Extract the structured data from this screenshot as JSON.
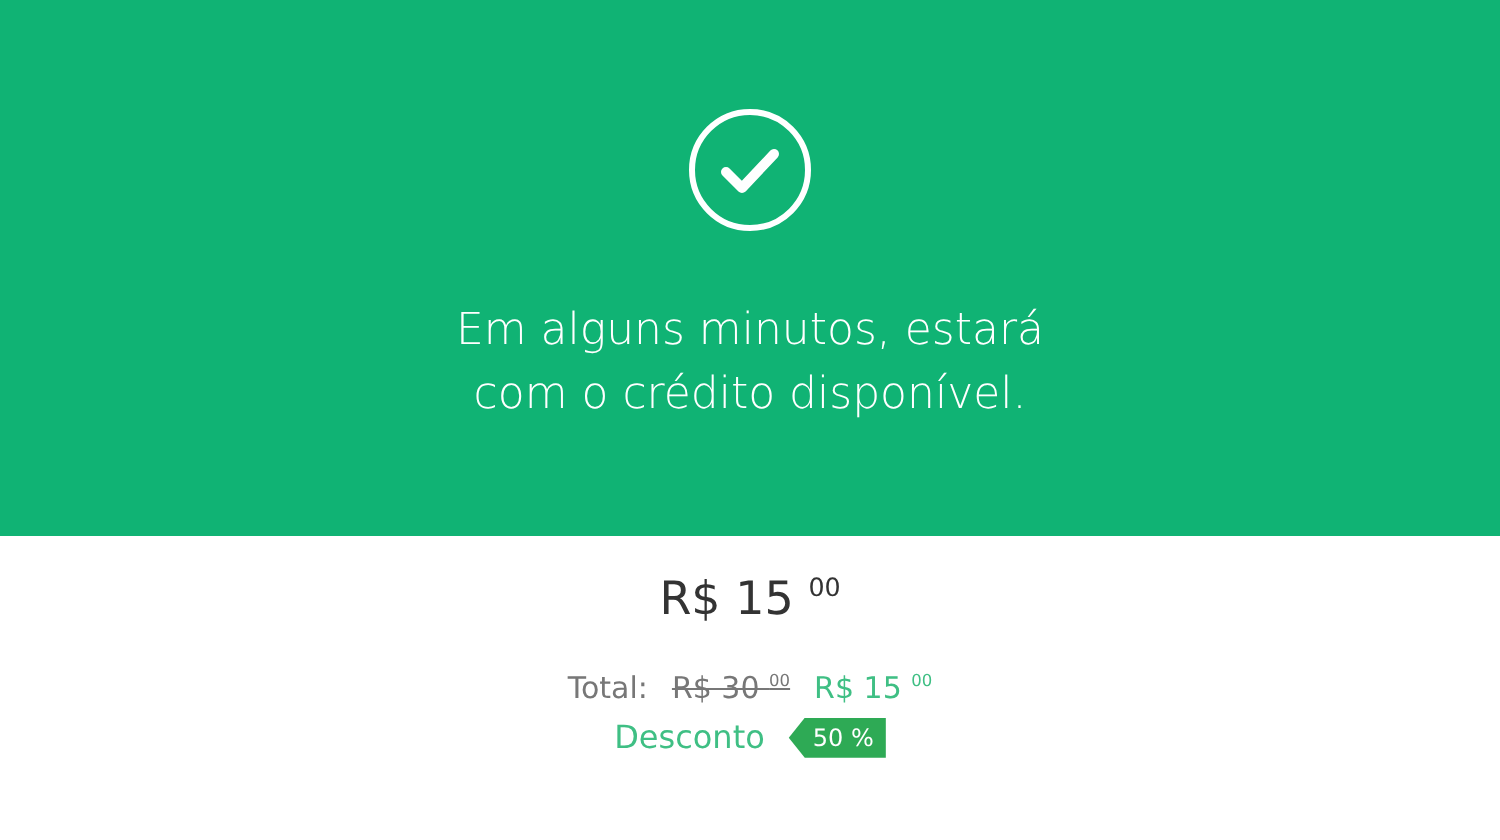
{
  "success": {
    "message": "Em alguns minutos, estará com o crédito disponível."
  },
  "summary": {
    "price": "R$ 15 $^{00}$",
    "total_label": "Total:",
    "original_price": "R$ 30 $^{00}$",
    "final_price": "R$ 15 $^{00}$",
    "discount_label": "Desconto",
    "discount_badge": "50 %"
  }
}
